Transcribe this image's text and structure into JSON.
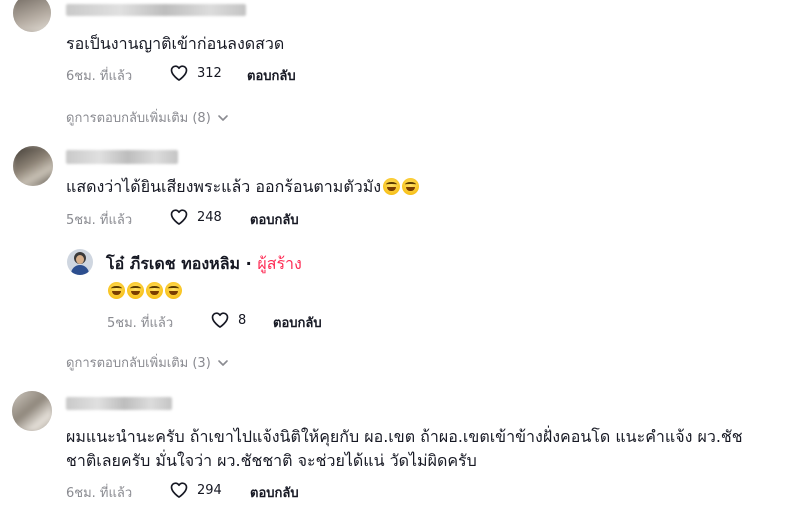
{
  "comments": [
    {
      "text": "รอเป็นงานญาติเข้าก่อนลงดสวด",
      "time": "6ชม. ที่แล้ว",
      "likes": "312",
      "reply_label": "ตอบกลับ",
      "more_replies": "ดูการตอบกลับเพิ่มเติม (8)"
    },
    {
      "text": "แสดงว่าได้ยินเสียงพระแล้ว ออกร้อนตามตัวมัง",
      "emoji_count": 2,
      "time": "5ชม. ที่แล้ว",
      "likes": "248",
      "reply_label": "ตอบกลับ",
      "creator_reply": {
        "author": "โอ๋ ภีรเดช ทองหลิม",
        "separator": "·",
        "badge": "ผู้สร้าง",
        "emoji_count": 4,
        "time": "5ชม. ที่แล้ว",
        "likes": "8",
        "reply_label": "ตอบกลับ"
      },
      "more_replies": "ดูการตอบกลับเพิ่มเติม (3)"
    },
    {
      "text_line1": "ผมแนะนำนะครับ ถ้าเขาไปแจ้งนิติให้คุยกับ ผอ.เขต ถ้าผอ.เขตเข้าข้างฝั่งคอนโด แนะคำแจ้ง ผว.ชัช",
      "text_line2": "ชาติเลยครับ มั่นใจว่า ผว.ชัชชาติ จะช่วยได้แน่ วัดไม่ผิดครับ",
      "time": "6ชม. ที่แล้ว",
      "likes": "294",
      "reply_label": "ตอบกลับ"
    }
  ],
  "icons": {
    "like": "heart-outline-icon",
    "expand": "chevron-down-icon"
  },
  "colors": {
    "creator_badge": "#fe2c55",
    "meta_text": "#8a8b91",
    "text": "#161823"
  }
}
